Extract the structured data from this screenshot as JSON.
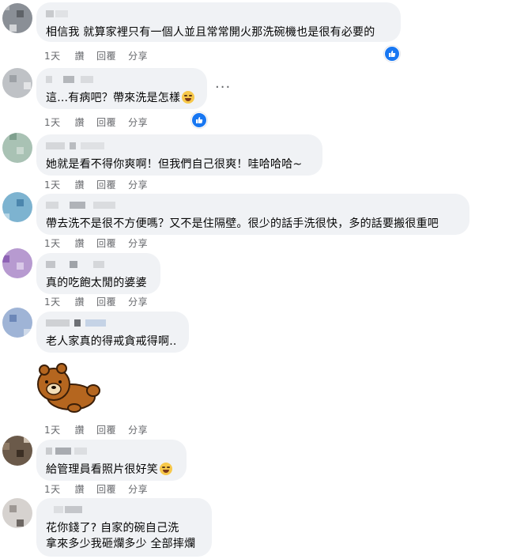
{
  "actions": {
    "time": "1天",
    "like": "讚",
    "reply": "回覆",
    "share": "分享"
  },
  "colors": {
    "bubble": "#f0f2f5",
    "like_blue": "#1877f2",
    "meta": "#65676b"
  },
  "comments": [
    {
      "text": "相信我 就算家裡只有一個人並且常常開火那洗碗機也是很有必要的",
      "liked": true
    },
    {
      "text": "這...有病吧？帶來洗是怎樣",
      "emoji": "grinning-squinting-face",
      "liked": true,
      "menu": "more-options-icon"
    },
    {
      "text": "她就是看不得你爽啊！但我們自己很爽！哇哈哈哈~"
    },
    {
      "text": "帶去洗不是很不方便嗎？又不是住隔壁。很少的話手洗很快，多的話要搬很重吧"
    },
    {
      "text": "真的吃飽太閒的婆婆"
    },
    {
      "text": "老人家真的得戒貪戒得啊..",
      "sticker": "rilakkuma-bear-lying-sticker"
    },
    {
      "text": "給管理員看照片很好笑",
      "emoji": "grinning-squinting-face"
    },
    {
      "text": "花你錢了? 自家的碗自己洗\n拿來多少我砸爛多少 全部摔爛"
    }
  ]
}
